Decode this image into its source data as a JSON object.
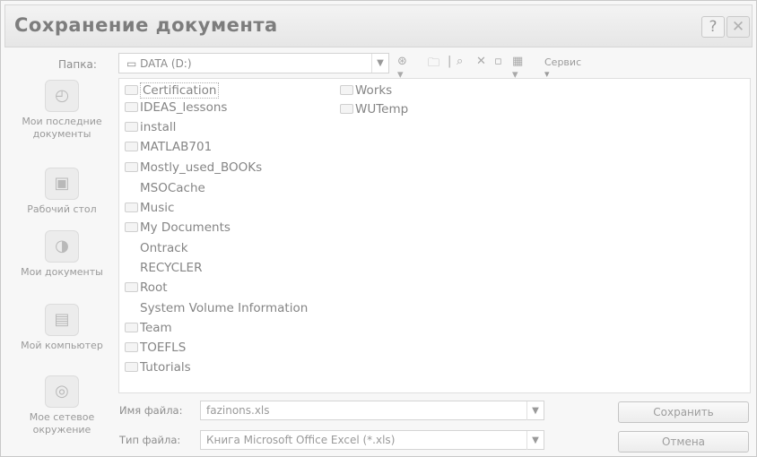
{
  "dialog": {
    "title": "Сохранение документа",
    "help_label": "?",
    "close_label": "✕"
  },
  "folder": {
    "label": "Папка:",
    "current": "DATA (D:)"
  },
  "toolbar": {
    "back_icon": "back-icon",
    "service_label": "Сервис"
  },
  "places": [
    {
      "label": "Мои последние документы",
      "icon": "recent-documents-icon"
    },
    {
      "label": "Рабочий стол",
      "icon": "desktop-icon"
    },
    {
      "label": "Мои документы",
      "icon": "my-documents-icon"
    },
    {
      "label": "Мой компьютер",
      "icon": "my-computer-icon"
    },
    {
      "label": "Мое сетевое окружение",
      "icon": "network-places-icon"
    }
  ],
  "files": [
    {
      "name": "Certification",
      "folder": true
    },
    {
      "name": "IDEAS_lessons",
      "folder": true
    },
    {
      "name": "install",
      "folder": true
    },
    {
      "name": "MATLAB701",
      "folder": true
    },
    {
      "name": "Mostly_used_BOOKs",
      "folder": true
    },
    {
      "name": "MSOCache",
      "folder": false
    },
    {
      "name": "Music",
      "folder": true
    },
    {
      "name": "My Documents",
      "folder": true
    },
    {
      "name": "Ontrack",
      "folder": false
    },
    {
      "name": "RECYCLER",
      "folder": false
    },
    {
      "name": "Root",
      "folder": true
    },
    {
      "name": "System Volume Information",
      "folder": false
    },
    {
      "name": "Team",
      "folder": true
    },
    {
      "name": "TOEFLS",
      "folder": true
    },
    {
      "name": "Tutorials",
      "folder": true
    },
    {
      "name": "Works",
      "folder": true
    },
    {
      "name": "WUTemp",
      "folder": true
    }
  ],
  "filename": {
    "label": "Имя файла:",
    "value": "fazinons.xls"
  },
  "filetype": {
    "label": "Тип файла:",
    "value": "Книга Microsoft Office Excel (*.xls)"
  },
  "buttons": {
    "save": "Сохранить",
    "cancel": "Отмена"
  }
}
